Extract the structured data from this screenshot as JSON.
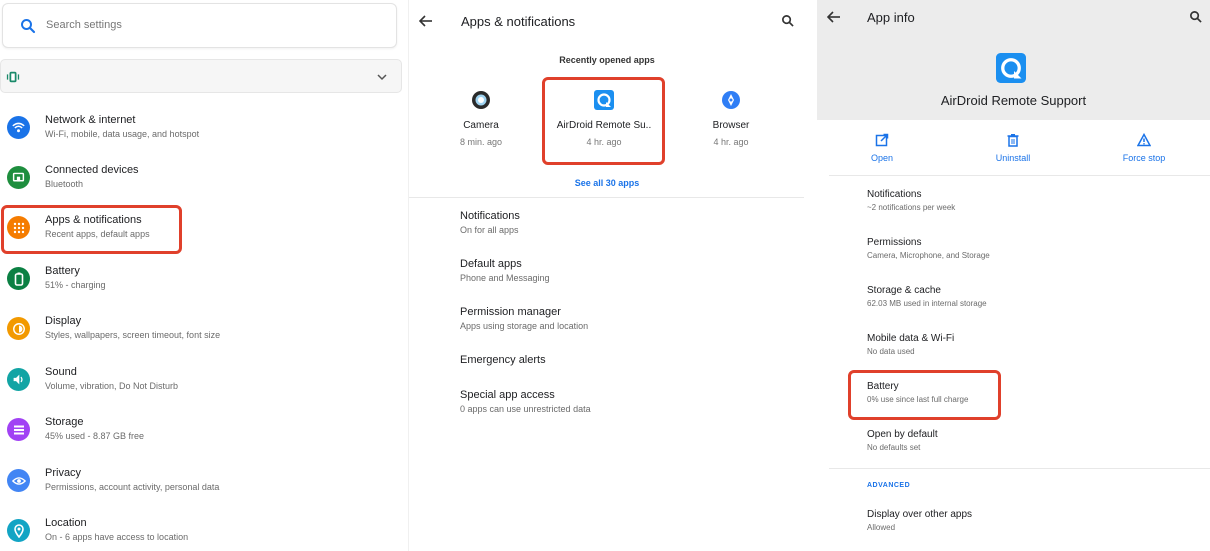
{
  "settings_home": {
    "search_placeholder": "Search settings",
    "items": [
      {
        "title": "Network & internet",
        "subtitle": "Wi-Fi, mobile, data usage, and hotspot",
        "color": "#1a73e8",
        "icon": "wifi-icon"
      },
      {
        "title": "Connected devices",
        "subtitle": "Bluetooth",
        "color": "#1e8e3e",
        "icon": "devices-icon"
      },
      {
        "title": "Apps & notifications",
        "subtitle": "Recent apps, default apps",
        "color": "#f57c00",
        "icon": "apps-grid-icon"
      },
      {
        "title": "Battery",
        "subtitle": "51% - charging",
        "color": "#0b8043",
        "icon": "battery-icon"
      },
      {
        "title": "Display",
        "subtitle": "Styles, wallpapers, screen timeout, font size",
        "color": "#f29900",
        "icon": "display-brightness-icon"
      },
      {
        "title": "Sound",
        "subtitle": "Volume, vibration, Do Not Disturb",
        "color": "#12a4a4",
        "icon": "volume-icon"
      },
      {
        "title": "Storage",
        "subtitle": "45% used - 8.87 GB free",
        "color": "#a142f4",
        "icon": "storage-icon"
      },
      {
        "title": "Privacy",
        "subtitle": "Permissions, account activity, personal data",
        "color": "#4285f4",
        "icon": "privacy-icon"
      },
      {
        "title": "Location",
        "subtitle": "On - 6 apps have access to location",
        "color": "#12a4c4",
        "icon": "location-pin-icon"
      }
    ]
  },
  "apps_notifications": {
    "title": "Apps & notifications",
    "recent_heading": "Recently opened apps",
    "recent_apps": [
      {
        "name": "Camera",
        "time": "8 min. ago"
      },
      {
        "name": "AirDroid Remote Su..",
        "time": "4 hr. ago"
      },
      {
        "name": "Browser",
        "time": "4 hr. ago"
      }
    ],
    "see_all": "See all 30 apps",
    "rows": [
      {
        "title": "Notifications",
        "subtitle": "On for all apps"
      },
      {
        "title": "Default apps",
        "subtitle": "Phone and Messaging"
      },
      {
        "title": "Permission manager",
        "subtitle": "Apps using storage and location"
      },
      {
        "title": "Emergency alerts",
        "subtitle": ""
      },
      {
        "title": "Special app access",
        "subtitle": "0 apps can use unrestricted data"
      }
    ]
  },
  "app_info": {
    "title": "App info",
    "app_name": "AirDroid Remote Support",
    "actions": {
      "open": "Open",
      "uninstall": "Uninstall",
      "force_stop": "Force stop"
    },
    "rows": [
      {
        "title": "Notifications",
        "subtitle": "~2 notifications per week"
      },
      {
        "title": "Permissions",
        "subtitle": "Camera, Microphone, and Storage"
      },
      {
        "title": "Storage & cache",
        "subtitle": "62.03 MB used in internal storage"
      },
      {
        "title": "Mobile data & Wi-Fi",
        "subtitle": "No data used"
      },
      {
        "title": "Battery",
        "subtitle": "0% use since last full charge"
      },
      {
        "title": "Open by default",
        "subtitle": "No defaults set"
      }
    ],
    "advanced_label": "ADVANCED",
    "advanced_rows": [
      {
        "title": "Display over other apps",
        "subtitle": "Allowed"
      }
    ]
  },
  "colors": {
    "accent": "#1a73e8",
    "highlight": "#e0402b"
  }
}
